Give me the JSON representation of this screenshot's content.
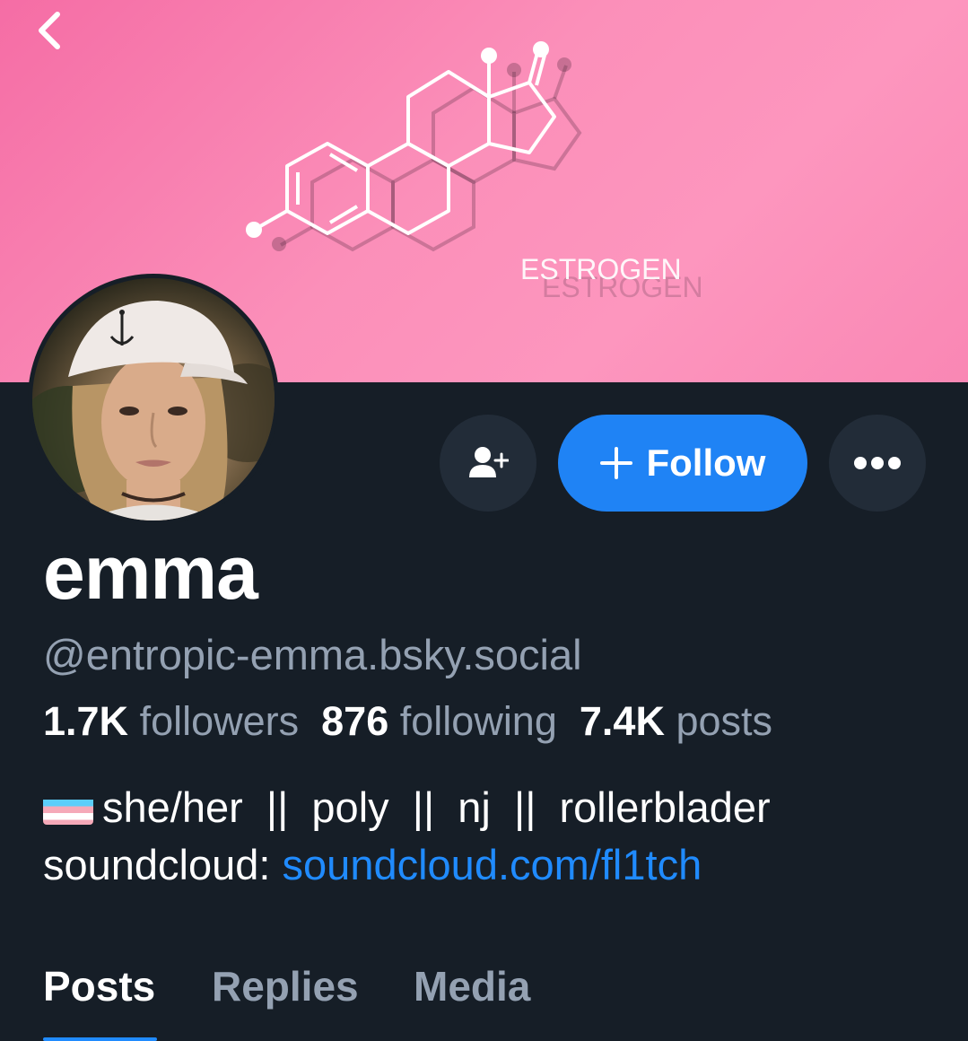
{
  "banner": {
    "text": "ESTROGEN",
    "icon": "estrogen-molecule"
  },
  "nav": {
    "back_icon": "chevron-left-icon"
  },
  "profile": {
    "display_name": "emma",
    "handle": "@entropic-emma.bsky.social",
    "avatar_icon": "avatar-photo"
  },
  "actions": {
    "add_user_icon": "add-user-icon",
    "follow_label": "Follow",
    "follow_icon": "plus-icon",
    "more_icon": "more-options-icon"
  },
  "stats": {
    "followers_count": "1.7K",
    "followers_label": "followers",
    "following_count": "876",
    "following_label": "following",
    "posts_count": "7.4K",
    "posts_label": "posts"
  },
  "bio": {
    "flag_icon": "transgender-flag-icon",
    "line1": "she/her  ||  poly  ||  nj  ||  rollerblader",
    "line2_prefix": "soundcloud: ",
    "link_text": "soundcloud.com/fl1tch"
  },
  "tabs": [
    {
      "label": "Posts",
      "active": true
    },
    {
      "label": "Replies",
      "active": false
    },
    {
      "label": "Media",
      "active": false
    }
  ],
  "colors": {
    "background": "#161e27",
    "accent": "#1f83f5",
    "link": "#208bfe",
    "muted": "#94a1b2",
    "banner_pink": "#fb8fb9"
  }
}
